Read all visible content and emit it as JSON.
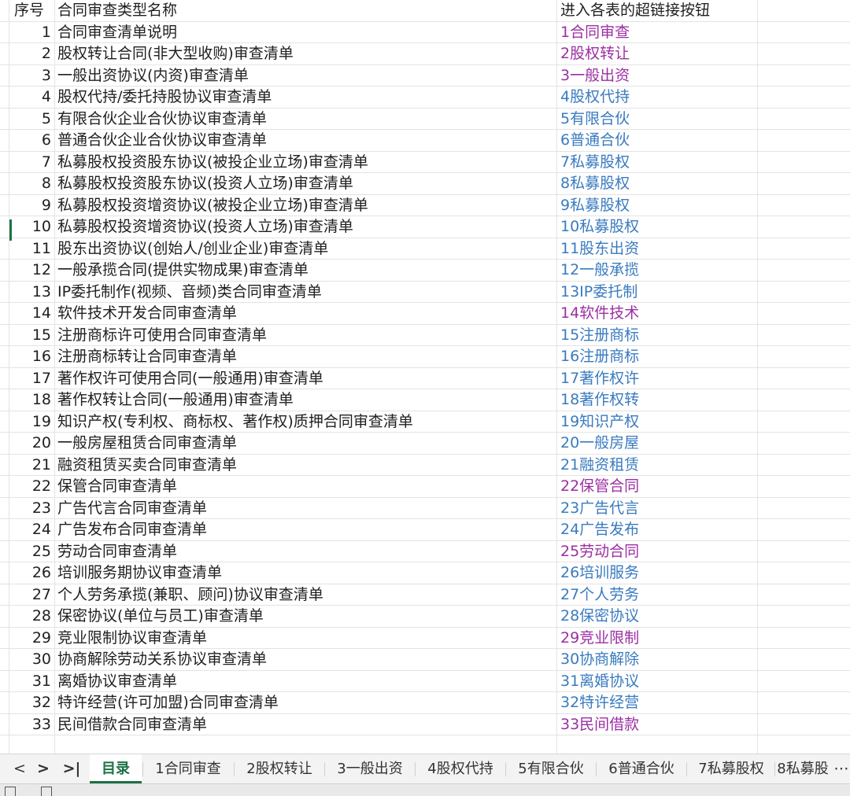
{
  "header": {
    "num": "序号",
    "name": "合同审查类型名称",
    "link": "进入各表的超链接按钮"
  },
  "rows": [
    {
      "n": "1",
      "name": "合同审查清单说明",
      "link": "1合同审查",
      "visited": true
    },
    {
      "n": "2",
      "name": "股权转让合同(非大型收购)审查清单",
      "link": "2股权转让",
      "visited": true
    },
    {
      "n": "3",
      "name": "一般出资协议(内资)审查清单",
      "link": "3一般出资",
      "visited": true
    },
    {
      "n": "4",
      "name": "股权代持/委托持股协议审查清单",
      "link": "4股权代持",
      "visited": false
    },
    {
      "n": "5",
      "name": "有限合伙企业合伙协议审查清单",
      "link": "5有限合伙",
      "visited": false
    },
    {
      "n": "6",
      "name": "普通合伙企业合伙协议审查清单",
      "link": "6普通合伙",
      "visited": false
    },
    {
      "n": "7",
      "name": "私募股权投资股东协议(被投企业立场)审查清单",
      "link": "7私募股权",
      "visited": false
    },
    {
      "n": "8",
      "name": "私募股权投资股东协议(投资人立场)审查清单",
      "link": "8私募股权",
      "visited": false
    },
    {
      "n": "9",
      "name": "私募股权投资增资协议(被投企业立场)审查清单",
      "link": "9私募股权",
      "visited": false
    },
    {
      "n": "10",
      "name": "私募股权投资增资协议(投资人立场)审查清单",
      "link": "10私募股权",
      "visited": false
    },
    {
      "n": "11",
      "name": "股东出资协议(创始人/创业企业)审查清单",
      "link": "11股东出资",
      "visited": false
    },
    {
      "n": "12",
      "name": "一般承揽合同(提供实物成果)审查清单",
      "link": "12一般承揽",
      "visited": false
    },
    {
      "n": "13",
      "name": "IP委托制作(视频、音频)类合同审查清单",
      "link": "13IP委托制",
      "visited": false
    },
    {
      "n": "14",
      "name": "软件技术开发合同审查清单",
      "link": "14软件技术",
      "visited": true
    },
    {
      "n": "15",
      "name": "注册商标许可使用合同审查清单",
      "link": "15注册商标",
      "visited": false
    },
    {
      "n": "16",
      "name": "注册商标转让合同审查清单",
      "link": "16注册商标",
      "visited": false
    },
    {
      "n": "17",
      "name": "著作权许可使用合同(一般通用)审查清单",
      "link": "17著作权许",
      "visited": false
    },
    {
      "n": "18",
      "name": "著作权转让合同(一般通用)审查清单",
      "link": "18著作权转",
      "visited": false
    },
    {
      "n": "19",
      "name": "知识产权(专利权、商标权、著作权)质押合同审查清单",
      "link": "19知识产权",
      "visited": false
    },
    {
      "n": "20",
      "name": "一般房屋租赁合同审查清单",
      "link": "20一般房屋",
      "visited": false
    },
    {
      "n": "21",
      "name": "融资租赁买卖合同审查清单",
      "link": "21融资租赁",
      "visited": false
    },
    {
      "n": "22",
      "name": "保管合同审查清单",
      "link": "22保管合同",
      "visited": true
    },
    {
      "n": "23",
      "name": "广告代言合同审查清单",
      "link": "23广告代言",
      "visited": false
    },
    {
      "n": "24",
      "name": "广告发布合同审查清单",
      "link": "24广告发布",
      "visited": false
    },
    {
      "n": "25",
      "name": "劳动合同审查清单",
      "link": "25劳动合同",
      "visited": true
    },
    {
      "n": "26",
      "name": "培训服务期协议审查清单",
      "link": "26培训服务",
      "visited": false
    },
    {
      "n": "27",
      "name": "个人劳务承揽(兼职、顾问)协议审查清单",
      "link": "27个人劳务",
      "visited": false
    },
    {
      "n": "28",
      "name": "保密协议(单位与员工)审查清单",
      "link": "28保密协议",
      "visited": false
    },
    {
      "n": "29",
      "name": "竞业限制协议审查清单",
      "link": "29竞业限制",
      "visited": true
    },
    {
      "n": "30",
      "name": "协商解除劳动关系协议审查清单",
      "link": "30协商解除",
      "visited": false
    },
    {
      "n": "31",
      "name": "离婚协议审查清单",
      "link": "31离婚协议",
      "visited": false
    },
    {
      "n": "32",
      "name": "特许经营(许可加盟)合同审查清单",
      "link": "32特许经营",
      "visited": false
    },
    {
      "n": "33",
      "name": "民间借款合同审查清单",
      "link": "33民间借款",
      "visited": true
    }
  ],
  "colors": {
    "link": "#3a7bbf",
    "visited_link": "#9c2fa3",
    "active_tab": "#1e7145"
  },
  "nav": {
    "prev": "<",
    "next": ">",
    "last": ">|",
    "more": "⋯"
  },
  "tabs": [
    "目录",
    "1合同审查",
    "2股权转让",
    "3一般出资",
    "4股权代持",
    "5有限合伙",
    "6普通合伙",
    "7私募股权",
    "8私募股"
  ],
  "active_tab_index": 0
}
